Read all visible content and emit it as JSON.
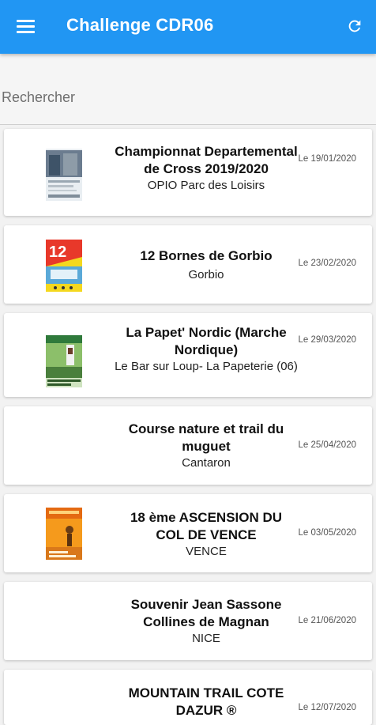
{
  "app": {
    "title": "Challenge CDR06"
  },
  "search": {
    "placeholder": "Rechercher"
  },
  "events": [
    {
      "title": "Championnat Departemental de Cross 2019/2020",
      "location": "OPIO Parc des Loisirs",
      "date": "Le 19/01/2020"
    },
    {
      "title": "12 Bornes de Gorbio",
      "location": "Gorbio",
      "date": "Le 23/02/2020"
    },
    {
      "title": "La Papet' Nordic (Marche Nordique)",
      "location": "Le Bar sur Loup- La Papeterie (06)",
      "date": "Le 29/03/2020"
    },
    {
      "title": "Course nature et trail du muguet",
      "location": "Cantaron",
      "date": "Le 25/04/2020"
    },
    {
      "title": "18 ème ASCENSION DU COL DE VENCE",
      "location": "VENCE",
      "date": "Le 03/05/2020"
    },
    {
      "title": "Souvenir Jean Sassone Collines de Magnan",
      "location": "NICE",
      "date": "Le 21/06/2020"
    },
    {
      "title": "MOUNTAIN TRAIL COTE DAZUR ®",
      "location": "",
      "date": "Le 12/07/2020"
    }
  ]
}
